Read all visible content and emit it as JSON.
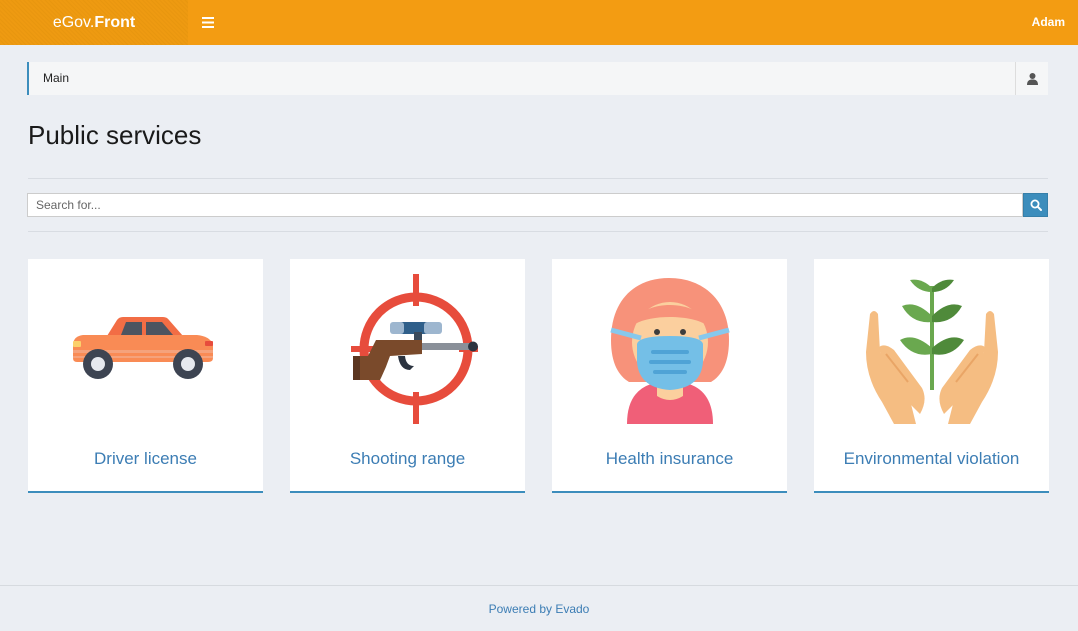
{
  "header": {
    "brand_plain": "eGov.",
    "brand_strong": "Front",
    "user": "Adam",
    "accent": "#f39c12"
  },
  "breadcrumb": {
    "current": "Main"
  },
  "page": {
    "title": "Public services"
  },
  "search": {
    "placeholder": "Search for...",
    "value": ""
  },
  "services": [
    {
      "label": "Driver license",
      "icon": "car-icon"
    },
    {
      "label": "Shooting range",
      "icon": "rifle-target-icon"
    },
    {
      "label": "Health insurance",
      "icon": "face-mask-person-icon"
    },
    {
      "label": "Environmental violation",
      "icon": "plant-hands-icon"
    }
  ],
  "footer": {
    "text": "Powered by Evado"
  },
  "colors": {
    "primary": "#3c8dbc",
    "link": "#3c7db4",
    "background": "#ebeef3"
  }
}
